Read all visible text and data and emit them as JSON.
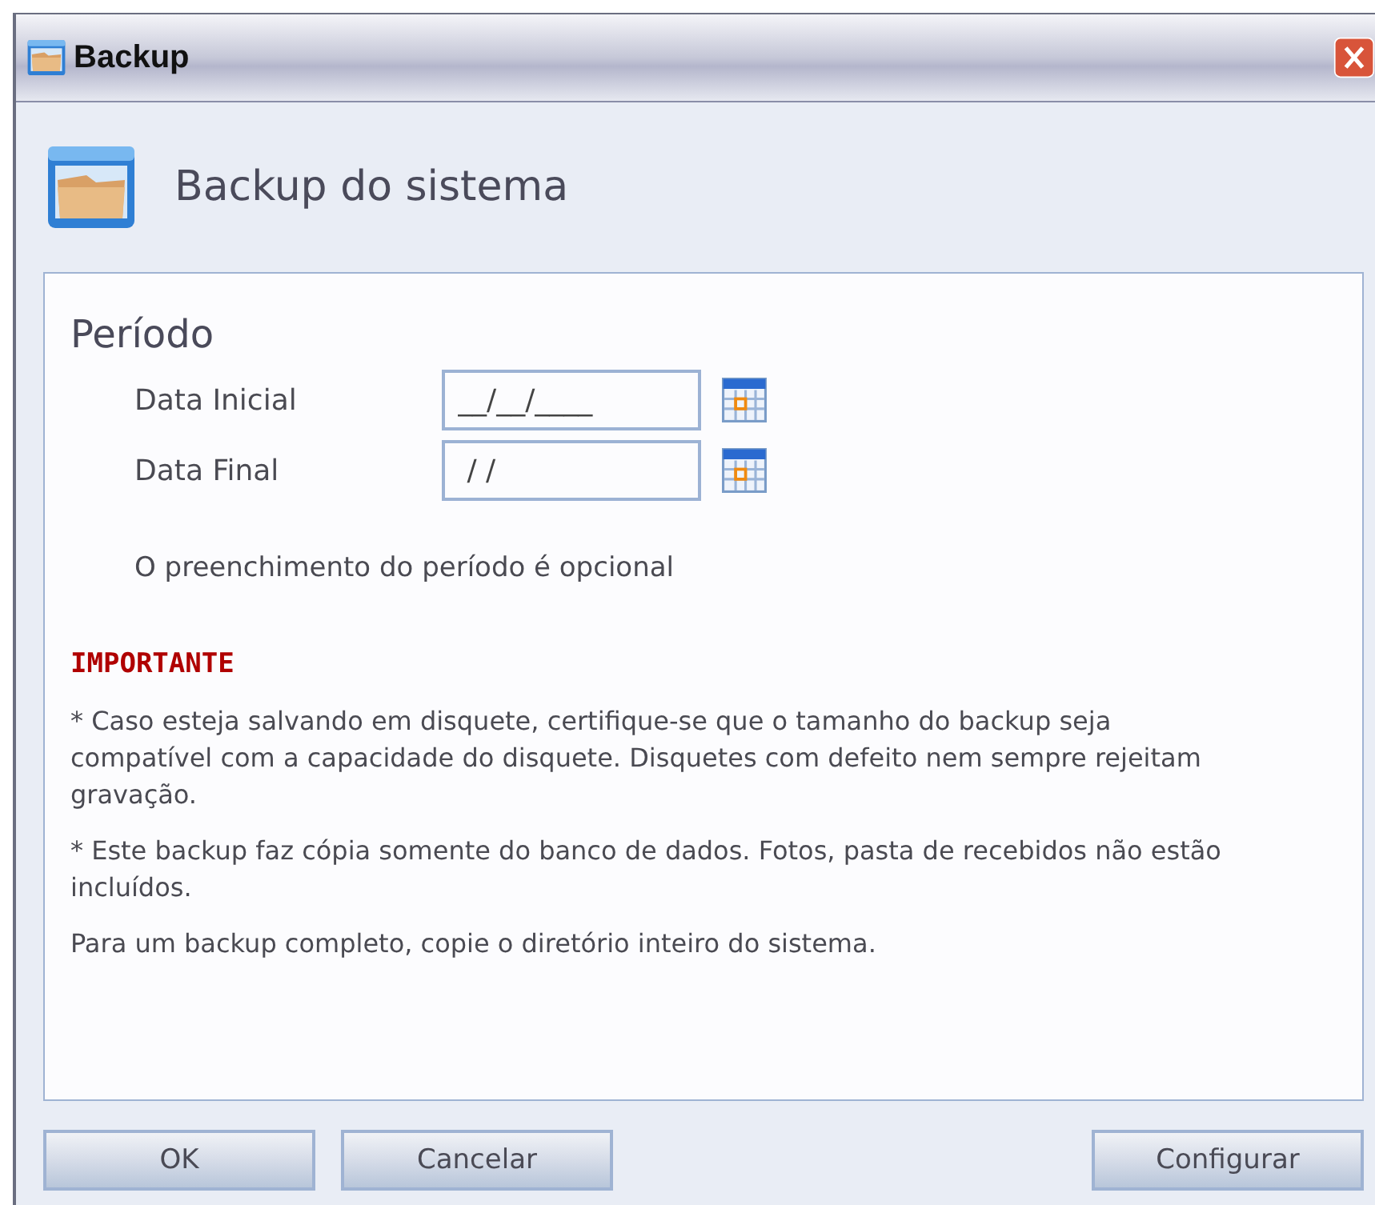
{
  "window": {
    "title": "Backup"
  },
  "header": {
    "title": "Backup do sistema"
  },
  "period": {
    "title": "Período",
    "fields": [
      {
        "label": "Data Inicial",
        "value": "__/__/____"
      },
      {
        "label": "Data Final",
        "value": " / /"
      }
    ],
    "note": "O preenchimento do período é opcional"
  },
  "important": {
    "title": "IMPORTANTE",
    "paragraphs": [
      "* Caso esteja salvando em disquete, certifique-se que o tamanho do backup seja compatível com a capacidade do disquete. Disquetes com defeito nem sempre rejeitam gravação.",
      "* Este backup faz cópia somente do banco de dados. Fotos, pasta de recebidos não estão incluídos.",
      "Para um backup completo, copie o diretório inteiro do sistema."
    ]
  },
  "buttons": {
    "left": [
      "OK",
      "Cancelar"
    ],
    "right": [
      "Configurar"
    ]
  }
}
